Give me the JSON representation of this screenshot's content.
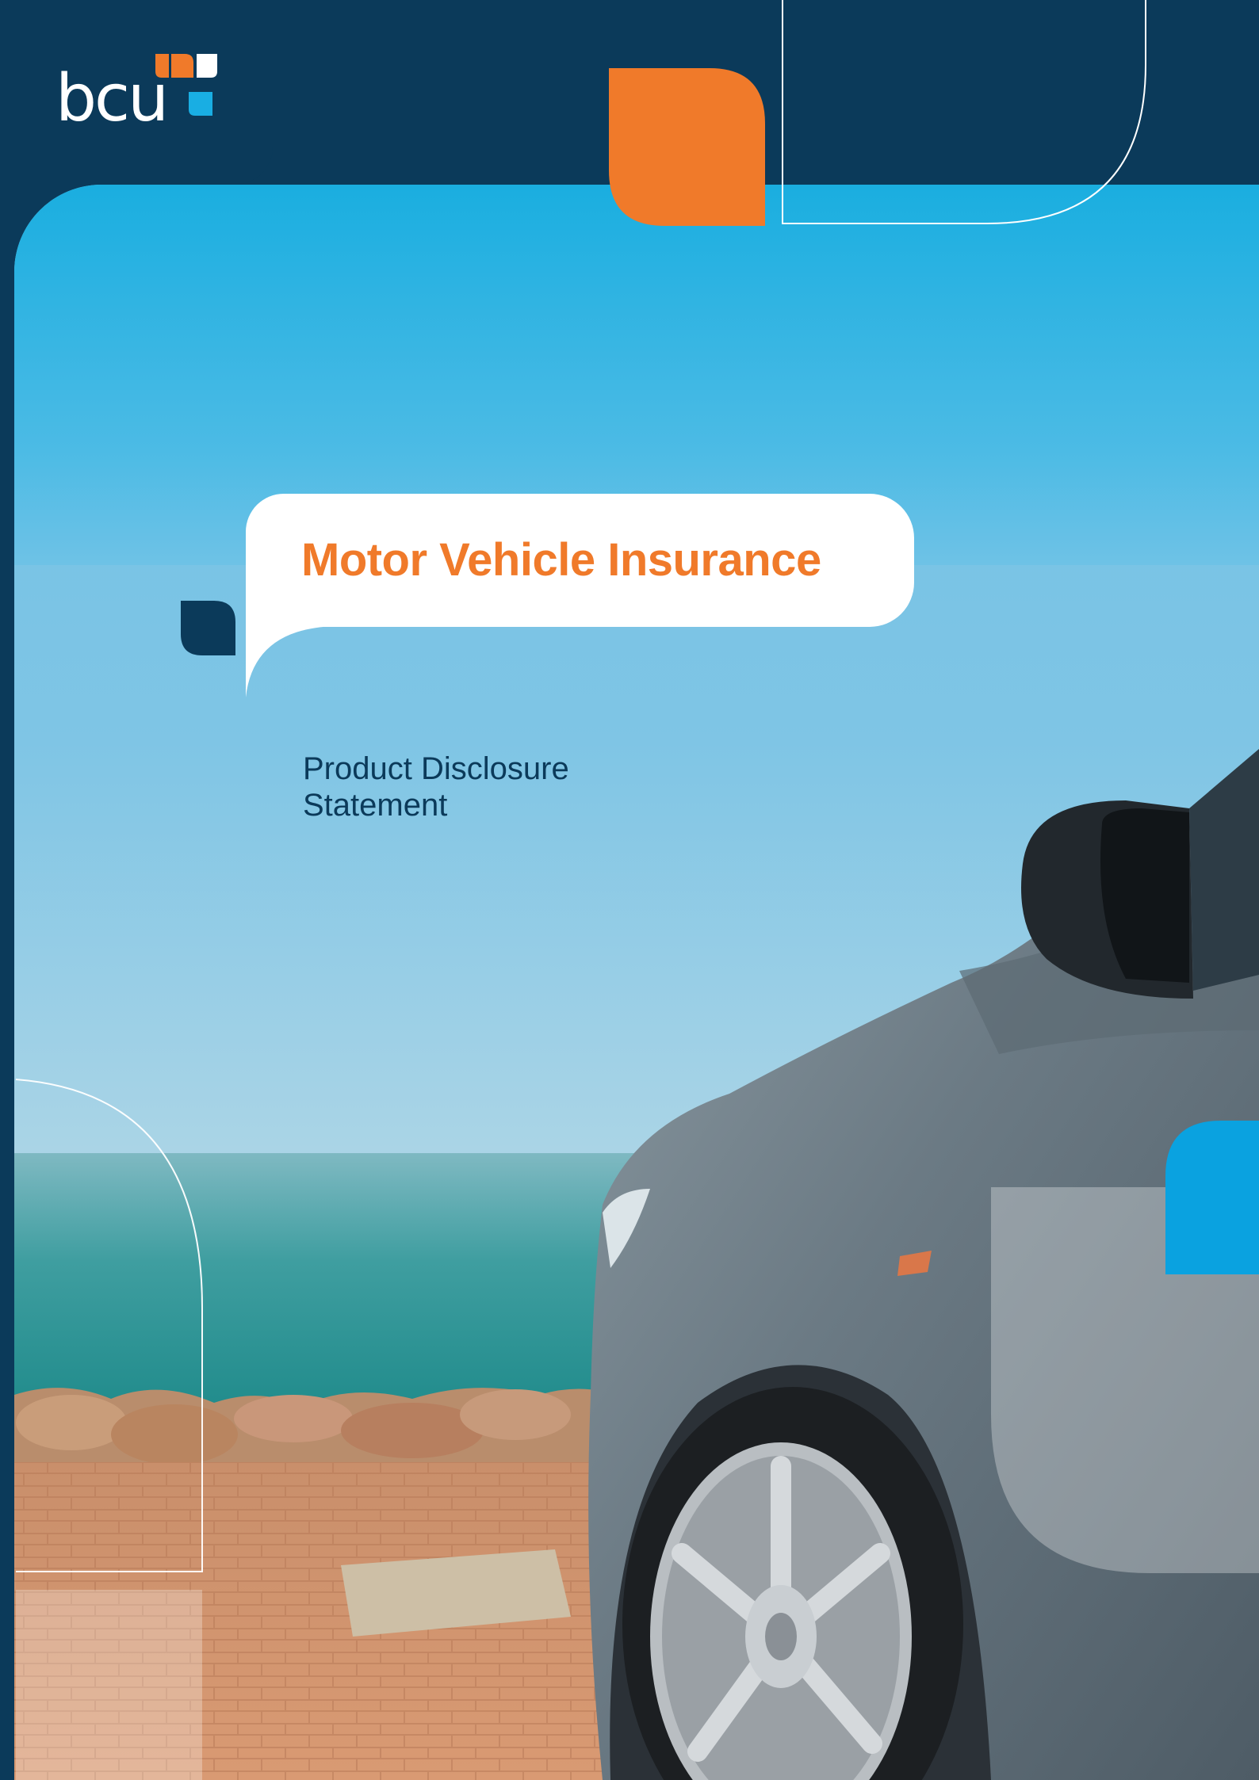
{
  "brand": {
    "logo_text": "bcu",
    "colors": {
      "navy": "#0b3a5a",
      "orange": "#f07a2a",
      "sky_blue": "#19aee3",
      "white": "#ffffff"
    }
  },
  "cover": {
    "title": "Motor Vehicle Insurance",
    "subtitle_line1": "Product Disclosure",
    "subtitle_line2": "Statement"
  },
  "decor": {
    "shapes": [
      "orange-leaf-icon",
      "outline-leaf-icon",
      "navy-leaf-icon",
      "blue-leaf-icon",
      "logo-leaf-icon"
    ]
  }
}
